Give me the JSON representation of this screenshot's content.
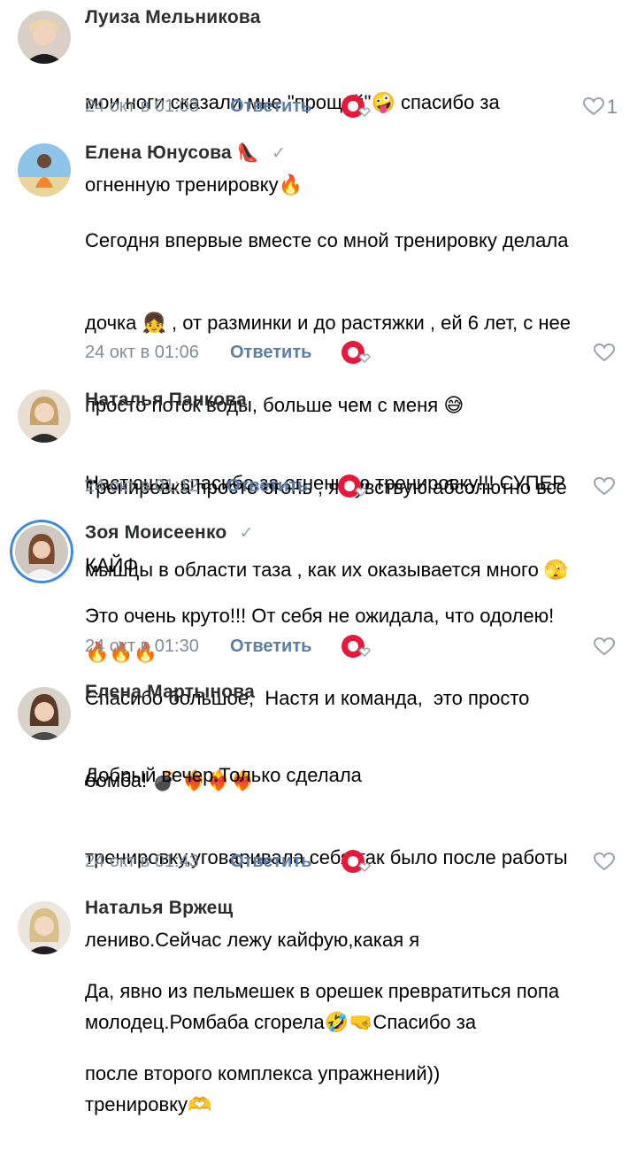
{
  "comments": [
    {
      "author": "Луиза Мельникова",
      "verified": false,
      "lines": [
        "мои ноги сказали мне \"прощай\"🤪 спасибо за",
        "огненную тренировку🔥"
      ],
      "date": "24 окт в 01:03",
      "reply_label": "Ответить",
      "likes": "1"
    },
    {
      "author": "Елена Юнусова",
      "author_emoji": "👠",
      "verified": true,
      "lines": [
        "Сегодня впервые вместе со мной тренировку делала",
        "дочка 👧 , от разминки и до растяжки , ей 6 лет, с нее",
        "просто поток воды, больше чем с меня 😅",
        "Тренировка просто огонь , я чувствую абсолютно все",
        "мышцы в области таза , как их оказывается много 🫣",
        "🔥🔥🔥"
      ],
      "date": "24 окт в 01:06",
      "reply_label": "Ответить",
      "likes": ""
    },
    {
      "author": "Наталья Панкова",
      "verified": false,
      "lines": [
        "Настюша, спасибо за огненную тренировку!!! СУПЕР",
        "КАЙФ"
      ],
      "date": "24 окт в 01:12",
      "reply_label": "Ответить",
      "likes": ""
    },
    {
      "author": "Зоя Моисеенко",
      "verified": true,
      "lines": [
        "Это очень круто!!! От себя не ожидала, что одолею!",
        "Спасибо большое,  Настя и команда,  это просто",
        "бомба! 💣 ❤️‍🔥❤️‍🔥❤️‍🔥"
      ],
      "date": "24 окт в 01:30",
      "reply_label": "Ответить",
      "likes": ""
    },
    {
      "author": "Елена Мартынова",
      "verified": false,
      "lines": [
        "Добрый вечер.Только сделала",
        "тренировку,уговаривала себя,так было после работы",
        "лениво.Сейчас лежу кайфую,какая я",
        "молодец.Ромбаба сгорела🤣🤜Спасибо за",
        "тренировку🫶"
      ],
      "date": "24 окт в 01:43",
      "reply_label": "Ответить",
      "likes": ""
    },
    {
      "author": "Наталья Вржещ",
      "verified": false,
      "lines": [
        "Да, явно из пельмешек в орешек превратиться попа",
        "после второго комплекса упражнений))"
      ],
      "date": "",
      "reply_label": "",
      "likes": ""
    }
  ],
  "icons": {
    "like": "heart-outline-icon",
    "verified": "checkmark-icon",
    "badge": "community-like-badge-icon"
  },
  "colors": {
    "name": "#2c2d2e",
    "meta": "#818c99",
    "reply": "#5c7ea6",
    "badge": "#e6193c",
    "verified": "#99a2ad"
  }
}
